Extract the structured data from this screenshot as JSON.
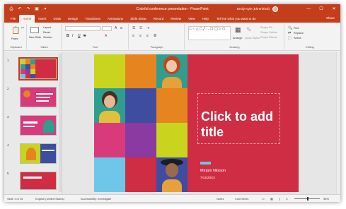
{
  "window": {
    "title": "Colorful conference presentation - PowerPoint",
    "user_name": "Emily Kyle (Ehrenfried)",
    "controls": [
      "—",
      "☐",
      "✕"
    ]
  },
  "colors": {
    "brand": "#c43e1c",
    "slide_bg": "#cf2d44",
    "tile_yellow": "#c9d41f",
    "tile_orange": "#e6841f",
    "tile_blue": "#3f4da0",
    "tile_pink": "#d93a7c",
    "tile_cyan": "#6ec6e8",
    "tile_purple": "#8a3aa0",
    "tile_green": "#2f9e8f"
  },
  "qat": {
    "icons": [
      "save-icon",
      "undo-icon",
      "redo-icon",
      "present-icon",
      "customize-icon"
    ],
    "glyphs": [
      "⎙",
      "↶",
      "↷",
      "▣",
      "▾"
    ]
  },
  "tabs": [
    {
      "label": "File"
    },
    {
      "label": "Home"
    },
    {
      "label": "Insert"
    },
    {
      "label": "Draw"
    },
    {
      "label": "Design"
    },
    {
      "label": "Transitions"
    },
    {
      "label": "Animations"
    },
    {
      "label": "Slide Show"
    },
    {
      "label": "Record"
    },
    {
      "label": "Review"
    },
    {
      "label": "View"
    },
    {
      "label": "Help"
    }
  ],
  "tell_me": "Tell me what you want to do",
  "share_label": "Share",
  "ribbon": {
    "clipboard": {
      "label": "Clipboard",
      "paste": "Paste"
    },
    "slides": {
      "label": "Slides",
      "new_slide": "New Slide",
      "layout": "Layout",
      "reset": "Reset",
      "section": "Section"
    },
    "font": {
      "label": "Font",
      "bold": "B",
      "italic": "I",
      "underline": "U",
      "strike": "S"
    },
    "paragraph": {
      "label": "Paragraph"
    },
    "drawing": {
      "label": "Drawing",
      "arrange": "Arrange",
      "quick_styles": "Quick Styles",
      "shape_fill": "Shape Fill",
      "shape_outline": "Shape Outline",
      "shape_effects": "Shape Effects"
    },
    "editing": {
      "label": "Editing",
      "find": "Find",
      "replace": "Replace",
      "select": "Select"
    }
  },
  "thumbnails": [
    {
      "num": "1"
    },
    {
      "num": "2"
    },
    {
      "num": "3"
    },
    {
      "num": "4"
    },
    {
      "num": "5"
    }
  ],
  "slide": {
    "title_placeholder": "Click to add title",
    "presenter": "Mirjam Nilsson",
    "date": "7/14/20XX"
  },
  "status": {
    "slide_count": "Slide 1 of 15",
    "language": "English (United States)",
    "accessibility": "Accessibility: Investigate",
    "notes": "Notes",
    "comments": "Comments",
    "zoom": "96%"
  }
}
